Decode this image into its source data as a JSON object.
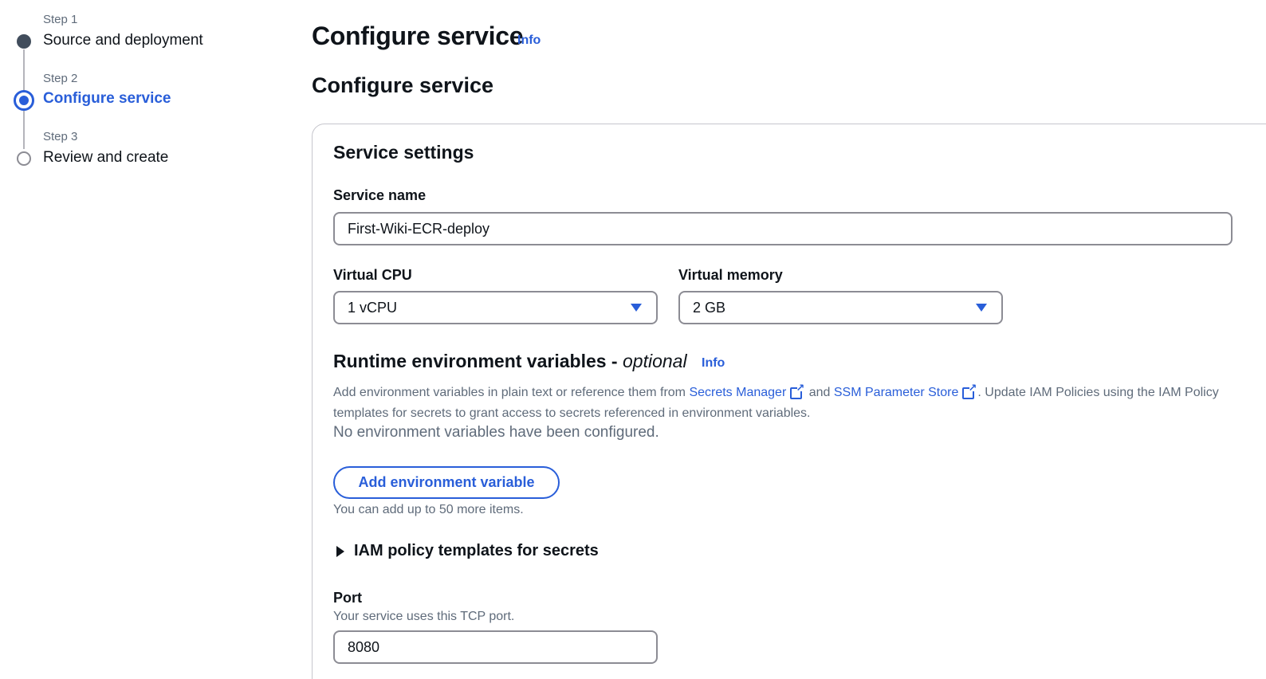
{
  "wizard": {
    "steps": [
      {
        "number": "Step 1",
        "title": "Source and deployment",
        "state": "complete"
      },
      {
        "number": "Step 2",
        "title": "Configure service",
        "state": "active"
      },
      {
        "number": "Step 3",
        "title": "Review and create",
        "state": "pending"
      }
    ]
  },
  "header": {
    "title": "Configure service",
    "info": "Info"
  },
  "section": {
    "title": "Configure service"
  },
  "service_settings": {
    "title": "Service settings",
    "service_name": {
      "label": "Service name",
      "value": "First-Wiki-ECR-deploy"
    },
    "virtual_cpu": {
      "label": "Virtual CPU",
      "value": "1 vCPU"
    },
    "virtual_memory": {
      "label": "Virtual memory",
      "value": "2 GB"
    }
  },
  "runtime_env": {
    "title": "Runtime environment variables - ",
    "optional": "optional",
    "info": "Info",
    "description_prefix": "Add environment variables in plain text or reference them from ",
    "secrets_manager_link": "Secrets Manager",
    "description_and": " and ",
    "ssm_link": "SSM Parameter Store",
    "description_suffix": ". Update IAM Policies using the IAM Policy templates for secrets to grant access to secrets referenced in environment variables.",
    "empty_message": "No environment variables have been configured.",
    "add_button": "Add environment variable",
    "constraint": "You can add up to 50 more items."
  },
  "iam_expander": {
    "label": "IAM policy templates for secrets"
  },
  "port": {
    "label": "Port",
    "description": "Your service uses this TCP port.",
    "value": "8080"
  },
  "colors": {
    "accent": "#295ed9",
    "text": "#0f141a",
    "muted": "#5f6b7a",
    "border": "#8c8c94"
  }
}
